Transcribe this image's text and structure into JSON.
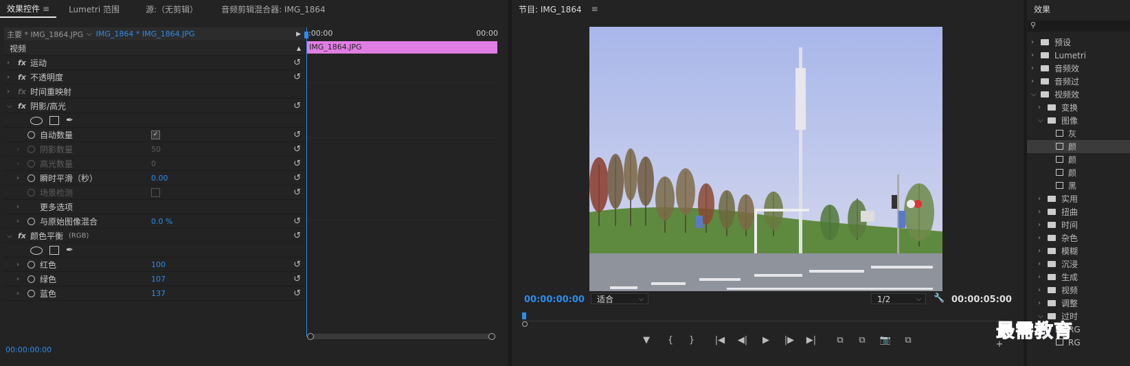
{
  "effect_controls": {
    "tabs": [
      "效果控件",
      "Lumetri 范围",
      "源:（无剪辑）",
      "音频剪辑混合器: IMG_1864"
    ],
    "menu": "≡",
    "master": "主要 * IMG_1864.JPG",
    "clip": "IMG_1864 * IMG_1864.JPG",
    "play": "▶",
    "section_video": "视频",
    "rows": [
      {
        "label": "运动"
      },
      {
        "label": "不透明度"
      },
      {
        "label": "时间重映射"
      },
      {
        "label": "阴影/高光"
      },
      {
        "label": "自动数量"
      },
      {
        "label": "阴影数量",
        "value": "50"
      },
      {
        "label": "高光数量",
        "value": "0"
      },
      {
        "label": "瞬时平滑（秒）",
        "value": "0.00"
      },
      {
        "label": "场景检测"
      },
      {
        "label": "更多选项"
      },
      {
        "label": "与原始图像混合",
        "value": "0.0 %"
      },
      {
        "label": "颜色平衡",
        "suffix": "(RGB)"
      },
      {
        "label": "红色",
        "value": "100"
      },
      {
        "label": "绿色",
        "value": "107"
      },
      {
        "label": "蓝色",
        "value": "137"
      }
    ],
    "timeline": {
      "start": ":00:00",
      "end": "00:00",
      "clip_name": "IMG_1864.JPG"
    },
    "bottom_tc": "00:00:00:00",
    "fx_glyph": "fx",
    "reset_glyph": "↺",
    "check_glyph": "✓"
  },
  "program_monitor": {
    "title": "节目: IMG_1864",
    "menu": "≡",
    "timecode_current": "00:00:00:00",
    "timecode_duration": "00:00:05:00",
    "zoom": "适合",
    "resolution": "1/2",
    "wrench": "🔧",
    "arrow": "⌵",
    "controls": [
      "▼",
      "{",
      "}",
      "|◀",
      "◀|",
      "▶",
      "|▶",
      "▶|",
      "⧉",
      "⧉",
      "📷",
      "⧉",
      "+"
    ]
  },
  "effects_panel": {
    "title": "效果",
    "search_icon": "⚲",
    "items": [
      "预设",
      "Lumetri",
      "音频效",
      "音频过",
      "视频效",
      "变换",
      "图像",
      "灰",
      "颜",
      "颜",
      "颜",
      "黑",
      "实用",
      "扭曲",
      "时间",
      "杂色",
      "模糊",
      "沉浸",
      "生成",
      "视频",
      "调整",
      "过时",
      "RG",
      "RG"
    ]
  },
  "watermark": "最需教育",
  "colors": {
    "accent": "#2d8ceb",
    "clip": "#e17ee3",
    "panel": "#232323",
    "watermark": "#1b33c7"
  }
}
